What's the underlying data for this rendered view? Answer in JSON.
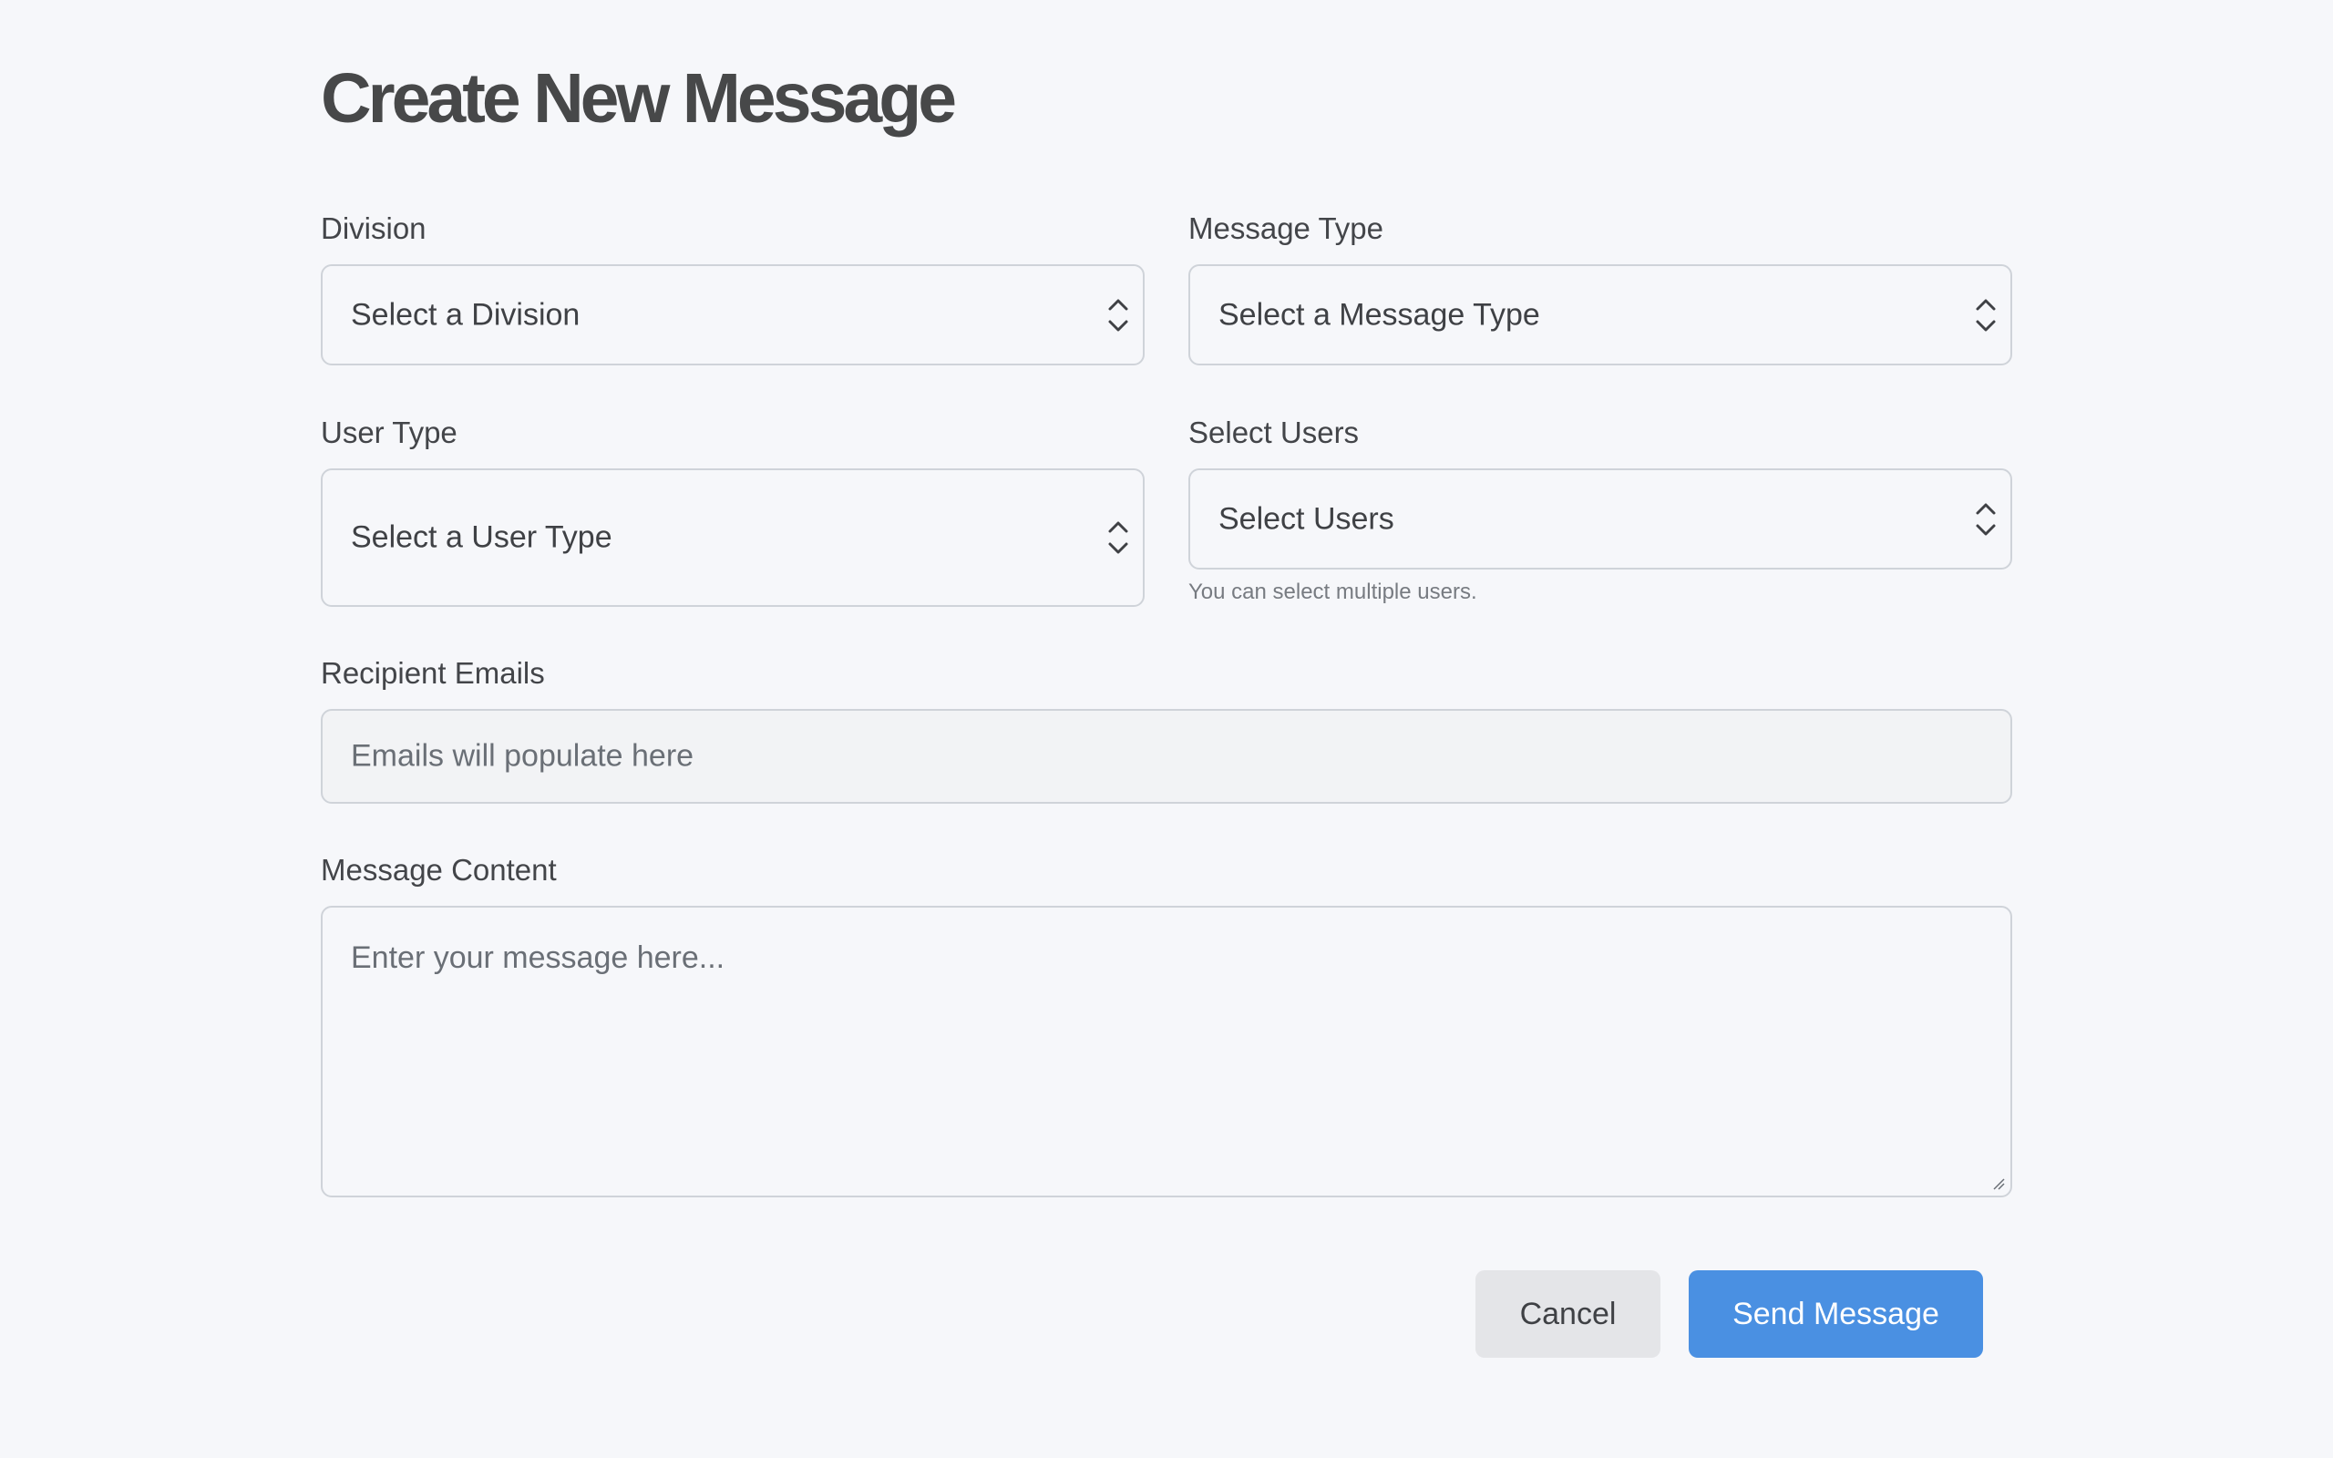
{
  "page": {
    "title": "Create New Message"
  },
  "form": {
    "division": {
      "label": "Division",
      "value": "Select a Division"
    },
    "message_type": {
      "label": "Message Type",
      "value": "Select a Message Type"
    },
    "user_type": {
      "label": "User Type",
      "value": "Select a User Type"
    },
    "select_users": {
      "label": "Select Users",
      "value": "Select Users",
      "hint": "You can select multiple users."
    },
    "recipient_emails": {
      "label": "Recipient Emails",
      "placeholder": "Emails will populate here"
    },
    "message_content": {
      "label": "Message Content",
      "placeholder": "Enter your message here..."
    }
  },
  "actions": {
    "cancel_label": "Cancel",
    "send_label": "Send Message"
  },
  "colors": {
    "background": "#f6f7fa",
    "primary_button": "#4a90e2",
    "secondary_button": "#e4e5e8",
    "border": "#cfd3d9"
  },
  "icons": {
    "select_indicator": "chevron-up-down-icon",
    "textarea_resize": "resize-grip-icon"
  }
}
